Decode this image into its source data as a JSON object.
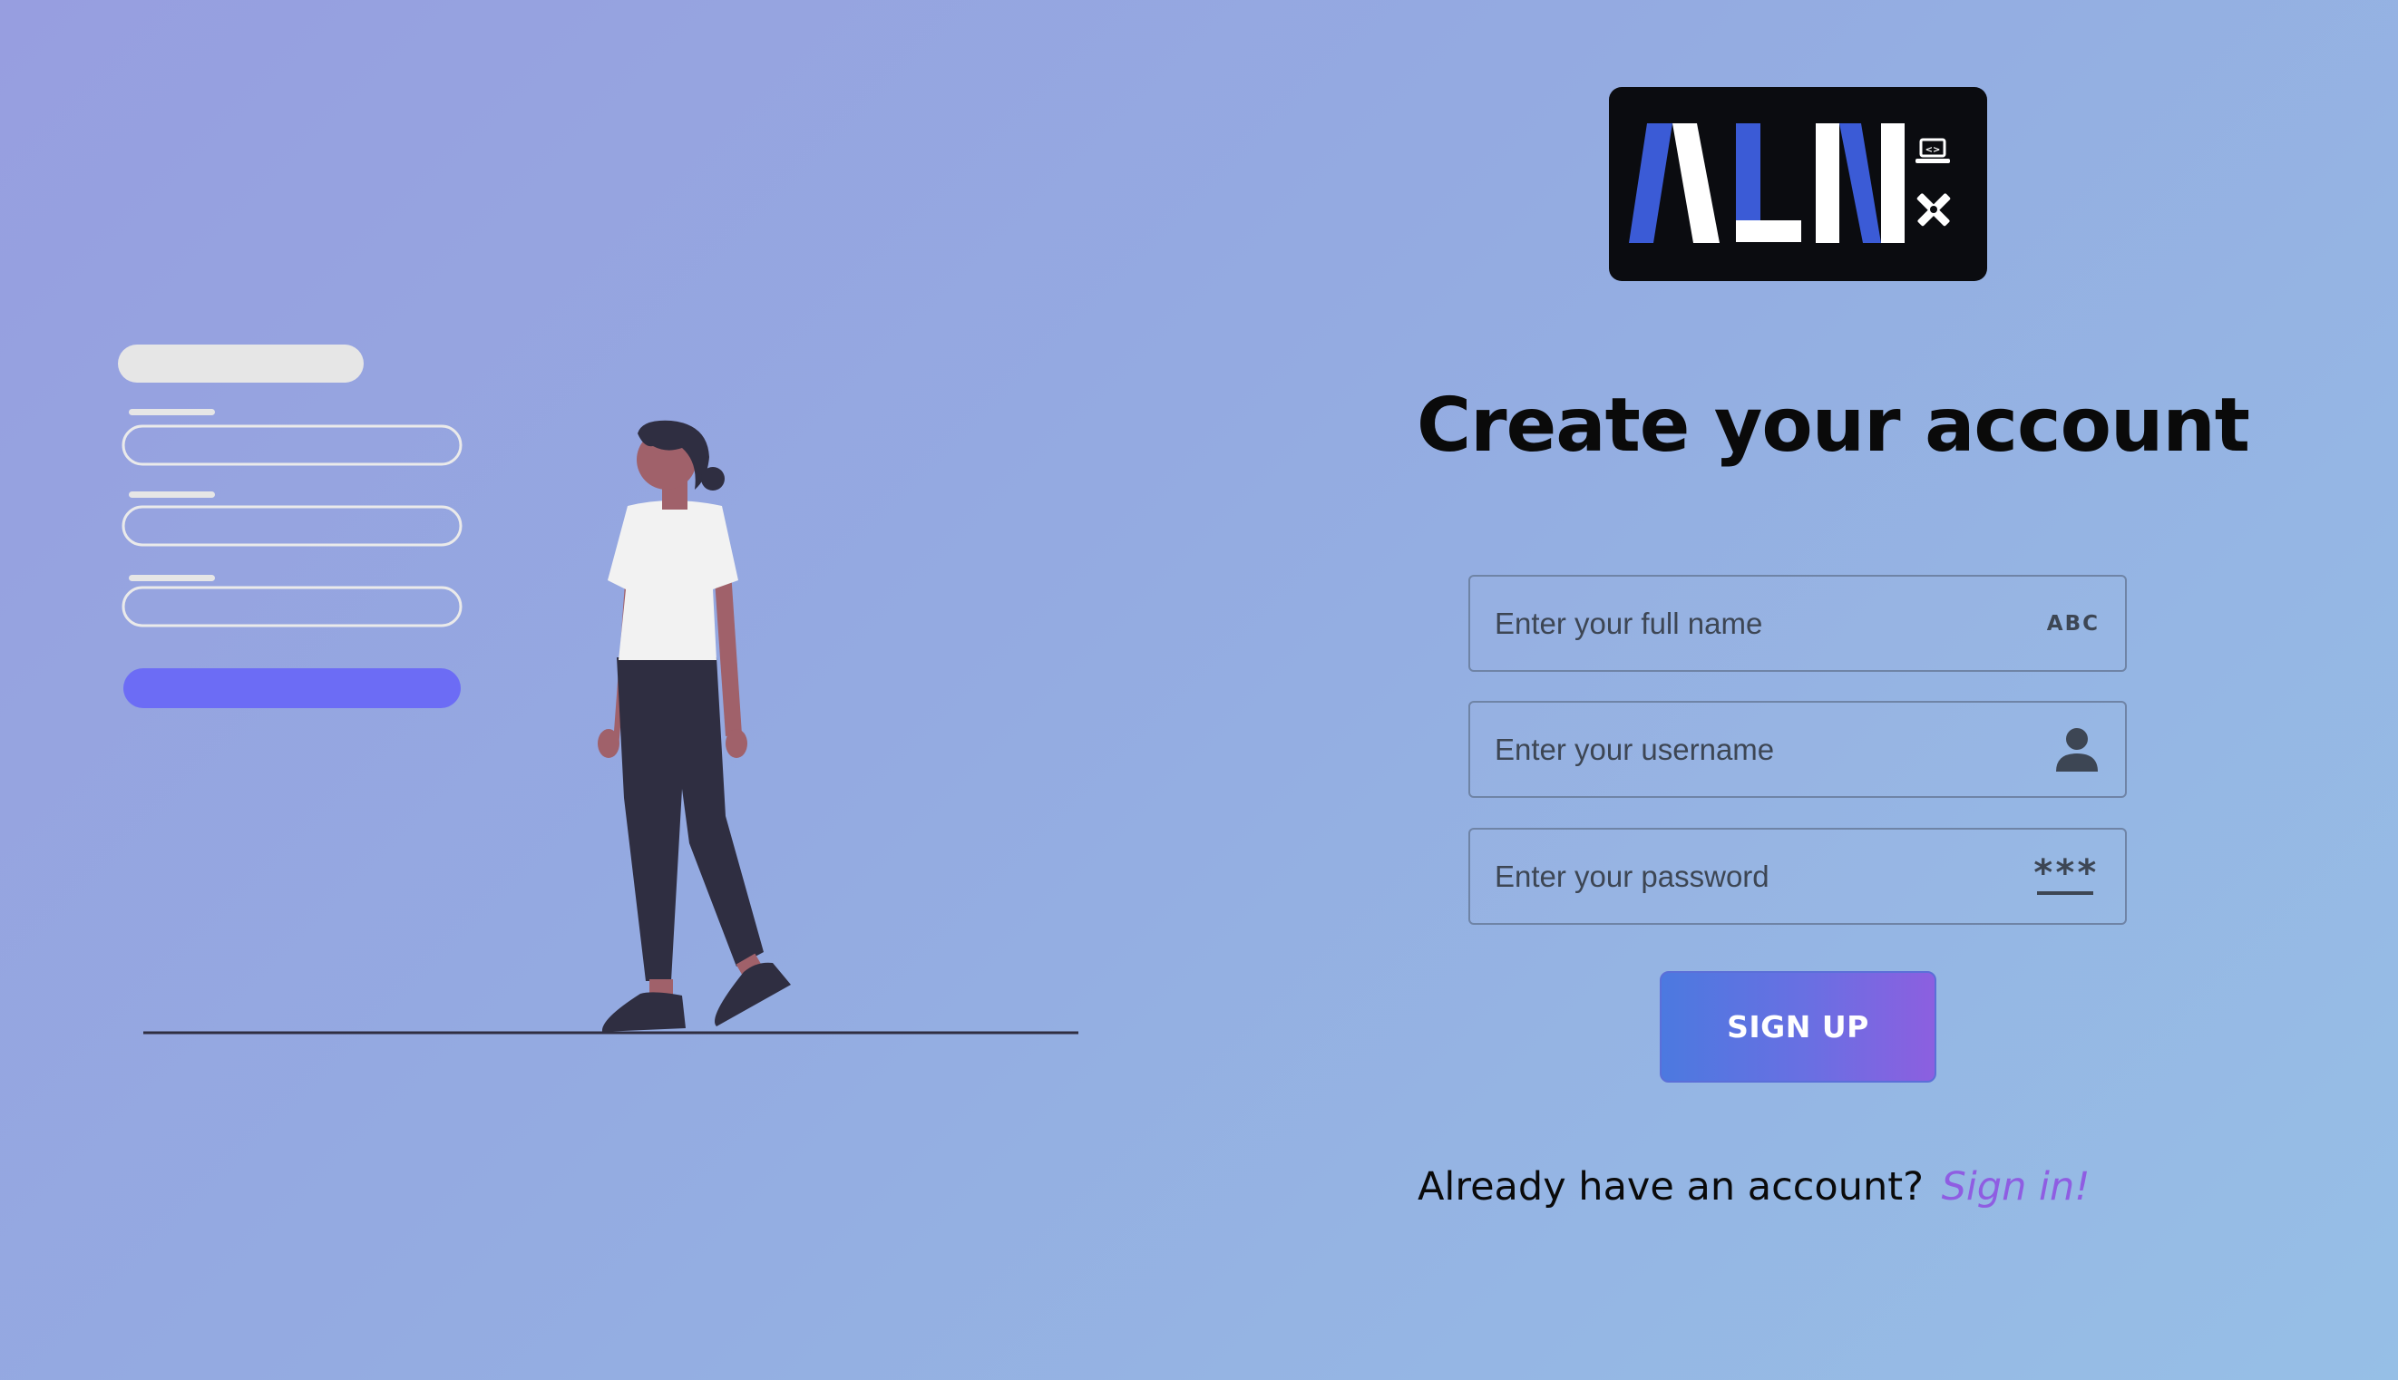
{
  "brand": {
    "logo_text": "ALN",
    "colors": {
      "logo_bg": "#0b0c10",
      "logo_blue": "#3b5bd6",
      "logo_white": "#ffffff"
    }
  },
  "form": {
    "title": "Create your account",
    "fields": [
      {
        "placeholder": "Enter your full name",
        "value": "",
        "icon": "abc-text-icon",
        "icon_text": "ABC"
      },
      {
        "placeholder": "Enter your username",
        "value": "",
        "icon": "user-icon"
      },
      {
        "placeholder": "Enter your password",
        "value": "",
        "icon": "password-asterisk-icon",
        "icon_text": "***"
      }
    ],
    "submit_label": "SIGN UP",
    "signin_prompt": "Already have an account?",
    "signin_link": "Sign in!"
  },
  "theme": {
    "background_start": "#979ee0",
    "background_end": "#96bfe6",
    "button_start": "#4c79e0",
    "button_end": "#8c5fe0",
    "link_color": "#8f5de2",
    "illustration_accent": "#6c6cf5"
  }
}
